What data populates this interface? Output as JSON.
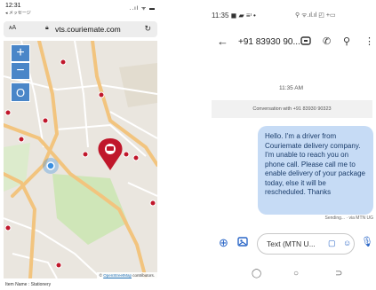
{
  "left_phone": {
    "status": {
      "time": "12:31",
      "subtitle": "◂ メッセージ",
      "icons": "..ıl ᯤ ▬"
    },
    "browser": {
      "aa_label": "ᴀA",
      "url": "vts.couriemate.com",
      "reload_icon": "reload-icon"
    },
    "map": {
      "zoom_in": "+",
      "zoom_out": "−",
      "locate": "O",
      "attribution_prefix": "© ",
      "attribution_link": "OpenStreetMap",
      "attribution_suffix": " contributors.",
      "colors": {
        "road_major": "#f2c47e",
        "road_minor": "#ffffff",
        "park": "#cfe6b8",
        "marker": "#c0172b",
        "location_dot": "#3b8fe0"
      }
    },
    "item_name": "Item Name : Stationery"
  },
  "right_phone": {
    "status": {
      "time": "11:35",
      "icons_left": "◼ ▰ ≡ᶦ •",
      "icons_right": "⚲ ᯤ.ıl.ıl ◰ +▭"
    },
    "header": {
      "contact": "+91 83930 90...",
      "icons": [
        "back-arrow-icon",
        "video-icon",
        "phone-icon",
        "search-icon",
        "more-vert-icon"
      ]
    },
    "date": "11:35 AM",
    "conversation_banner": "Conversation with +91 83930 90323",
    "message": "Hello. I'm a driver from Couriemate delivery company. I'm unable to reach you on phone call. Please call me to enable delivery of your package today, else it will be rescheduled. Thanks",
    "sent_status": "Sending... · via MTN UG",
    "compose": {
      "placeholder": "Text (MTN U...",
      "accent": "#2a66c7"
    },
    "nav": [
      "recents-icon",
      "home-icon",
      "back-icon"
    ]
  }
}
